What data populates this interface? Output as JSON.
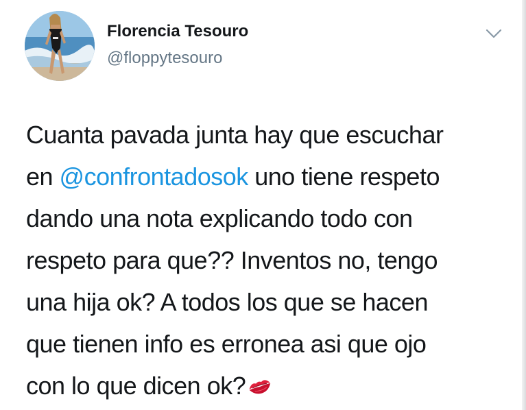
{
  "author": {
    "display_name": "Florencia Tesouro",
    "handle": "@floppytesouro",
    "avatar_icon": "profile-photo"
  },
  "menu": {
    "icon": "chevron-down-icon"
  },
  "tweet": {
    "lines": [
      {
        "text": "Cuanta pavada junta hay que escuchar"
      },
      {
        "before": "en ",
        "mention": "@confrontadosok",
        "after": " uno tiene respeto"
      },
      {
        "text": "dando una nota explicando todo con"
      },
      {
        "text": "respeto para que??  Inventos no, tengo"
      },
      {
        "text": "una hija ok? A todos los que se hacen"
      },
      {
        "text": "que tienen info es erronea asi que ojo"
      },
      {
        "text": "con lo que dicen ok?"
      }
    ],
    "emoji": "kiss-mark-icon"
  },
  "colors": {
    "mention": "#1b95e0",
    "handle": "#657786",
    "text": "#14171a",
    "emoji": "#e0203c"
  }
}
